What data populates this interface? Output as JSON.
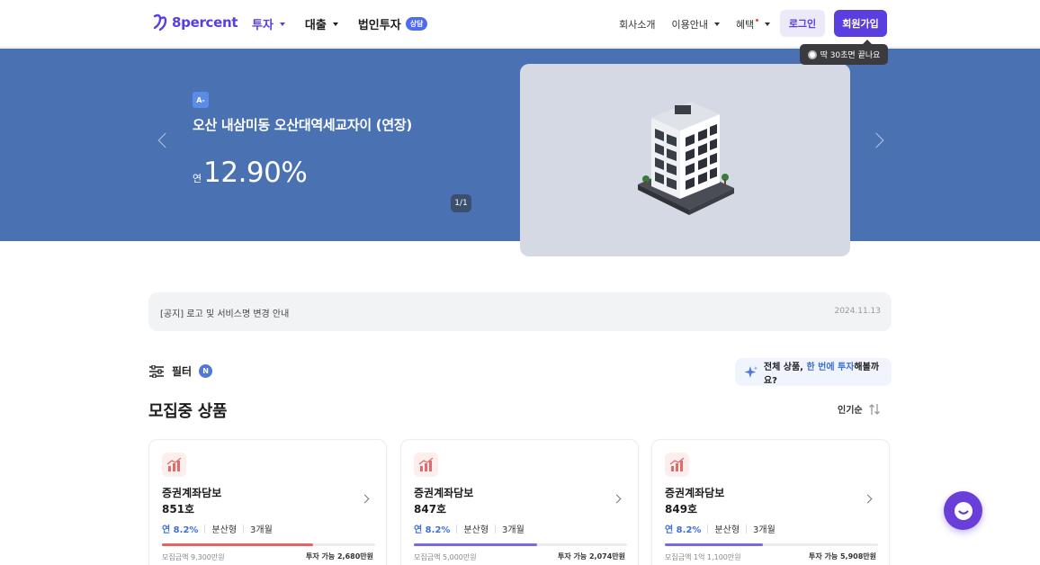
{
  "brand": {
    "name": "8percent",
    "accent": "#5a3ee0"
  },
  "nav_left": [
    {
      "label": "투자",
      "dropdown": true,
      "active": true
    },
    {
      "label": "대출",
      "dropdown": true,
      "active": false
    },
    {
      "label": "법인투자",
      "badge": "상담"
    }
  ],
  "nav_right": [
    {
      "label": "회사소개"
    },
    {
      "label": "이용안내",
      "dropdown": true
    },
    {
      "label": "혜택",
      "dropdown": true,
      "dot": true
    }
  ],
  "auth": {
    "login": "로그인",
    "signup": "회원가입",
    "tooltip": "딱 30초면 끝나요"
  },
  "hero": {
    "grade": "A-",
    "title": "오산 내삼미동 오산대역세교자이 (연장)",
    "rate_prefix": "연",
    "rate": "12.90%",
    "pager": "1/1",
    "background": "#4a71b1"
  },
  "notice": {
    "text": "[공지] 로고 및 서비스명 변경 안내",
    "date": "2024.11.13"
  },
  "filter": {
    "label": "필터",
    "badge": "N"
  },
  "promo": {
    "part1": "전체 상품, ",
    "highlight": "한 번에 투자",
    "part2": "해볼까요?"
  },
  "section": {
    "title": "모집중 상품",
    "sort": "인기순"
  },
  "cards": [
    {
      "type": "증권계좌담보",
      "number": "851호",
      "rate": "연 8.2%",
      "kind": "분산형",
      "term": "3개월",
      "progress": 0.71,
      "bar_color": "#e06464",
      "raised": "모집금액 9,300만원",
      "available": "투자 가능 2,680만원"
    },
    {
      "type": "증권계좌담보",
      "number": "847호",
      "rate": "연 8.2%",
      "kind": "분산형",
      "term": "3개월",
      "progress": 0.58,
      "bar_color": "#7b6bd6",
      "raised": "모집금액 5,000만원",
      "available": "투자 가능 2,074만원"
    },
    {
      "type": "증권계좌담보",
      "number": "849호",
      "rate": "연 8.2%",
      "kind": "분산형",
      "term": "3개월",
      "progress": 0.46,
      "bar_color": "#7b6bd6",
      "raised": "모집금액 1억 1,100만원",
      "available": "투자 가능 5,908만원"
    }
  ]
}
